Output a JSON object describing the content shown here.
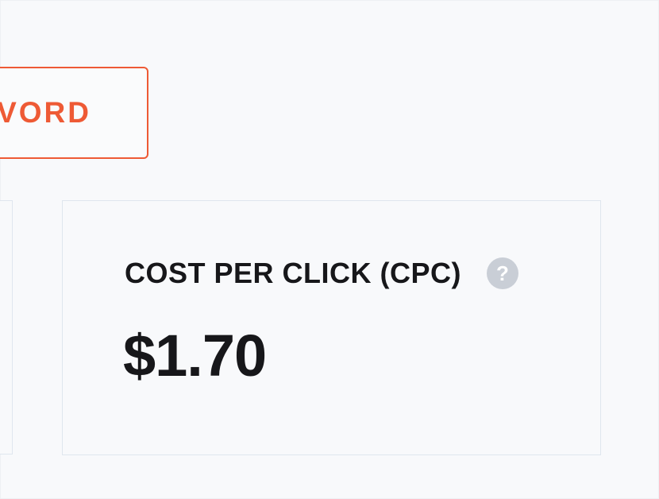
{
  "keyword_button": {
    "label": "VORD"
  },
  "cpc_card": {
    "title": "COST PER CLICK (CPC)",
    "help_icon": "question-mark-icon",
    "help_glyph": "?",
    "value": "$1.70"
  },
  "colors": {
    "accent": "#ee5a35",
    "text": "#17171a",
    "card_border": "#dfe6ee",
    "background": "#f8f9fb",
    "help_icon_bg": "#c9ced6"
  }
}
